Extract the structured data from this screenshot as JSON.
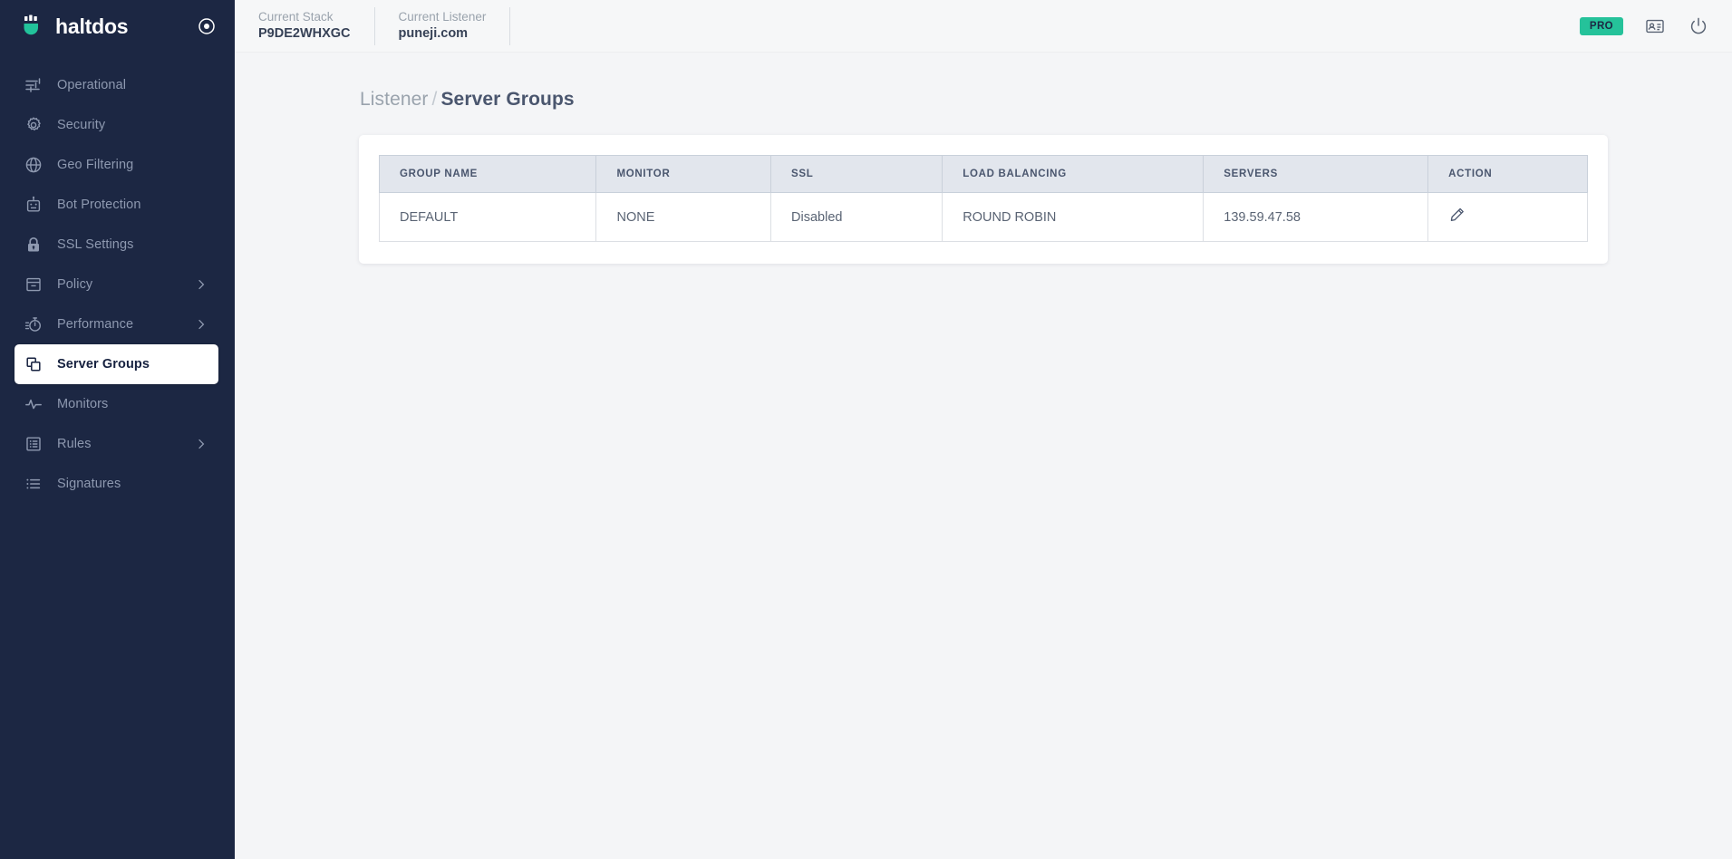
{
  "brand": {
    "name": "haltdos",
    "logo_icon": "haltdos-logo-icon",
    "collapse_icon": "target-circle-icon",
    "accent_color": "#25c29a",
    "sidebar_color": "#1c2743"
  },
  "sidebar": {
    "items": [
      {
        "label": "Operational",
        "icon": "sliders-icon",
        "active": false,
        "expandable": false
      },
      {
        "label": "Security",
        "icon": "gear-icon",
        "active": false,
        "expandable": false
      },
      {
        "label": "Geo Filtering",
        "icon": "globe-icon",
        "active": false,
        "expandable": false
      },
      {
        "label": "Bot Protection",
        "icon": "robot-icon",
        "active": false,
        "expandable": false
      },
      {
        "label": "SSL Settings",
        "icon": "lock-icon",
        "active": false,
        "expandable": false
      },
      {
        "label": "Policy",
        "icon": "archive-box-icon",
        "active": false,
        "expandable": true
      },
      {
        "label": "Performance",
        "icon": "stopwatch-icon",
        "active": false,
        "expandable": true
      },
      {
        "label": "Server Groups",
        "icon": "copy-layers-icon",
        "active": true,
        "expandable": false
      },
      {
        "label": "Monitors",
        "icon": "activity-pulse-icon",
        "active": false,
        "expandable": false
      },
      {
        "label": "Rules",
        "icon": "rules-list-icon",
        "active": false,
        "expandable": true
      },
      {
        "label": "Signatures",
        "icon": "list-icon",
        "active": false,
        "expandable": false
      }
    ]
  },
  "topbar": {
    "stack_label": "Current Stack",
    "stack_value": "P9DE2WHXGC",
    "listener_label": "Current Listener",
    "listener_value": "puneji.com",
    "pro_badge": "PRO",
    "docs_icon": "id-card-icon",
    "power_icon": "power-icon"
  },
  "breadcrumb": {
    "parent": "Listener",
    "separator": "/",
    "current": "Server Groups"
  },
  "table": {
    "columns": [
      "GROUP NAME",
      "MONITOR",
      "SSL",
      "LOAD BALANCING",
      "SERVERS",
      "ACTION"
    ],
    "rows": [
      {
        "group_name": "DEFAULT",
        "monitor": "NONE",
        "ssl": "Disabled",
        "load_balancing": "ROUND ROBIN",
        "servers": "139.59.47.58",
        "action_icon": "edit-pencil-icon"
      }
    ]
  }
}
